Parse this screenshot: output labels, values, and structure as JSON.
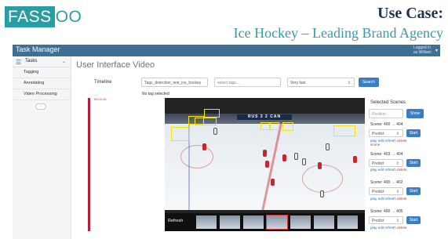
{
  "slide": {
    "logo_box": "FASS",
    "logo_rest": "OO",
    "heading": "Use Case:",
    "subtitle": "Ice Hockey – Leading Brand Agency"
  },
  "appbar": {
    "title": "Task Manager",
    "login_text": "Logged in as William"
  },
  "sidebar": {
    "header": "Tasks",
    "items": [
      {
        "label": "Tagging"
      },
      {
        "label": "Annotating"
      },
      {
        "label": "Video Processing"
      }
    ]
  },
  "main": {
    "title": "User Interface Video",
    "timeline_label": "Timeline",
    "video_name": "Tags_detection_test_ice_hockey",
    "tags_placeholder": "select tags...",
    "speed": "Very fast",
    "search_label": "Search",
    "no_tag": "No tag selected",
    "timeline_time": "00:21:24"
  },
  "video": {
    "scoreboard": "RUS 2 2 CAN",
    "refresh_label": "Refresh"
  },
  "scenes": {
    "title": "Selected Scenes",
    "position_placeholder": "Position",
    "show_label": "Show",
    "items": [
      {
        "label": "Scene: 400 → 404",
        "mode": "Predict",
        "start": "Start"
      },
      {
        "label": "Scene: 403 → 404",
        "mode": "Predict",
        "start": "Start"
      },
      {
        "label": "Scene: 400 → 402",
        "mode": "Predict",
        "start": "Start"
      },
      {
        "label": "Scene: 400 → 405",
        "mode": "Predict",
        "start": "Start"
      }
    ],
    "link_play": "play",
    "link_edit": "edit",
    "link_refresh": "refresh",
    "link_delete": "delete",
    "link_scene": "scene"
  },
  "colors": {
    "brand_teal": "#2a9da4",
    "heading_navy": "#1e3350",
    "appbar_blue": "#3f6f94",
    "button_blue": "#3d7ec3",
    "timeline_red": "#b41f3d",
    "detection_yellow": "#f4e40c"
  }
}
